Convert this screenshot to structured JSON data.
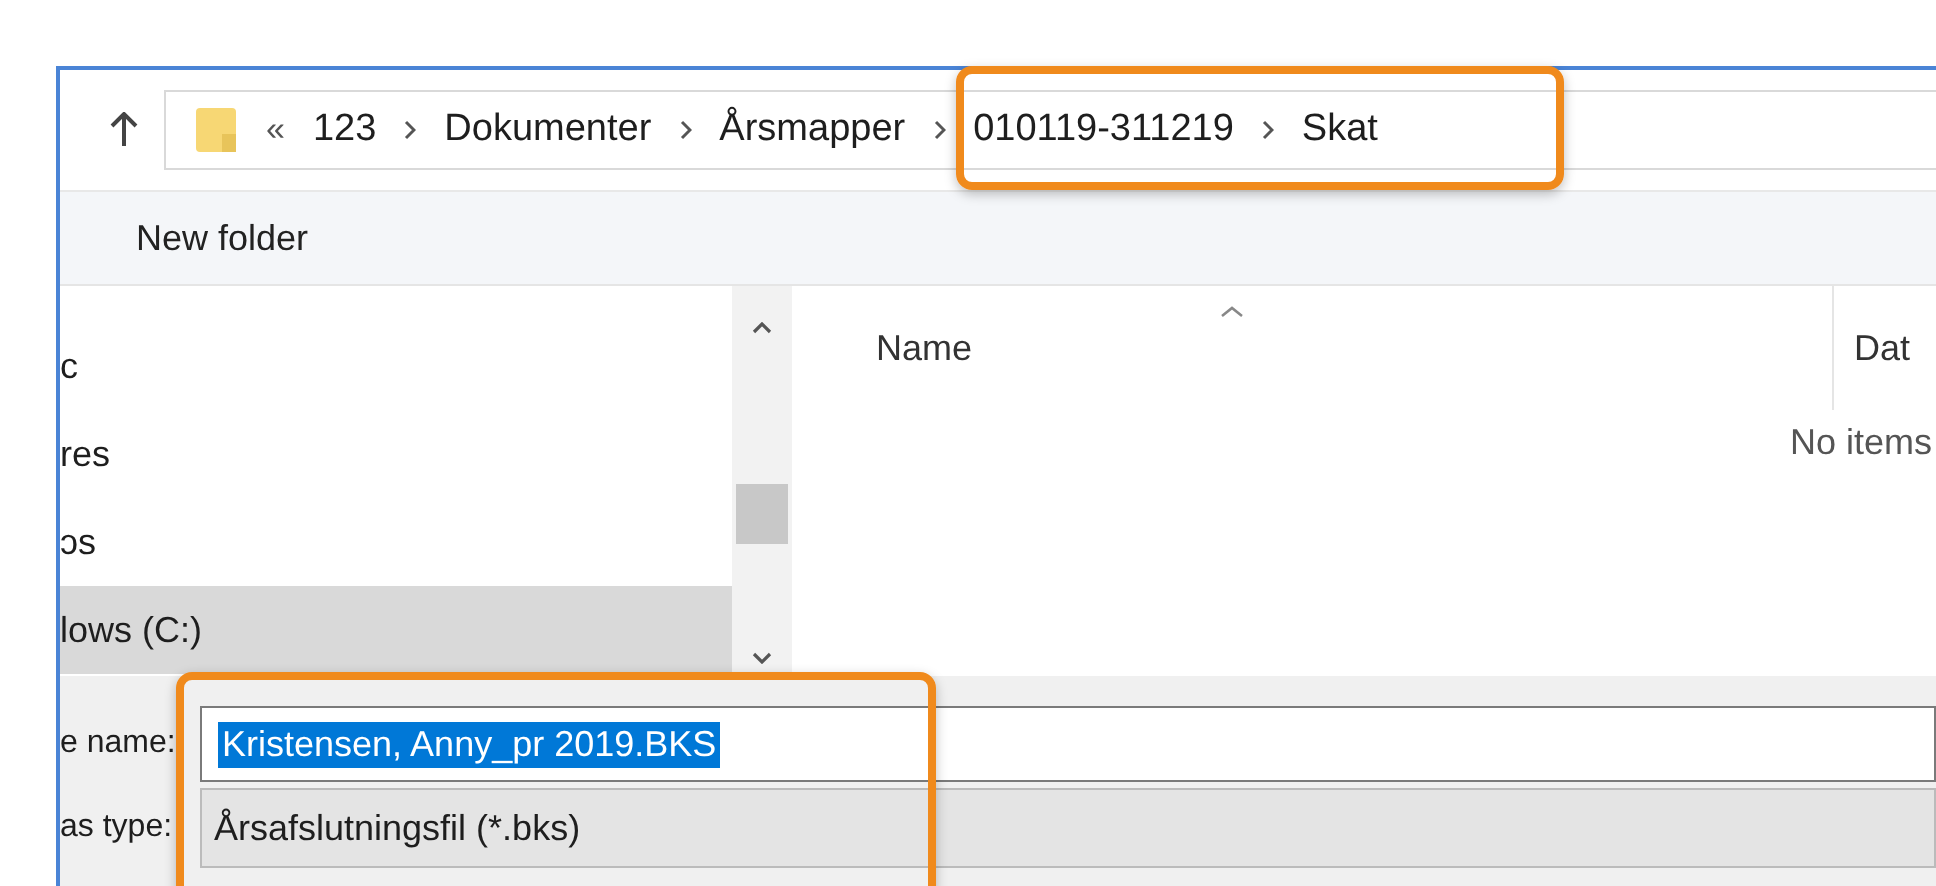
{
  "address_bar": {
    "overflow": "«",
    "crumbs": [
      "123",
      "Dokumenter",
      "Årsmapper",
      "010119-311219",
      "Skat"
    ]
  },
  "toolbar": {
    "new_folder": "New folder"
  },
  "nav_pane": {
    "items": [
      {
        "label": "c",
        "selected": false
      },
      {
        "label": "res",
        "selected": false
      },
      {
        "label": "ɔs",
        "selected": false
      },
      {
        "label": "lows (C:)",
        "selected": true
      }
    ]
  },
  "file_list": {
    "columns": [
      "Name",
      "Dat"
    ],
    "empty_text": "No items"
  },
  "save_fields": {
    "file_name_label": "e name:",
    "file_name": "Kristensen, Anny_pr 2019.BKS",
    "type_label": "as type:",
    "type_value": "Årsafslutningsfil (*.bks)"
  }
}
